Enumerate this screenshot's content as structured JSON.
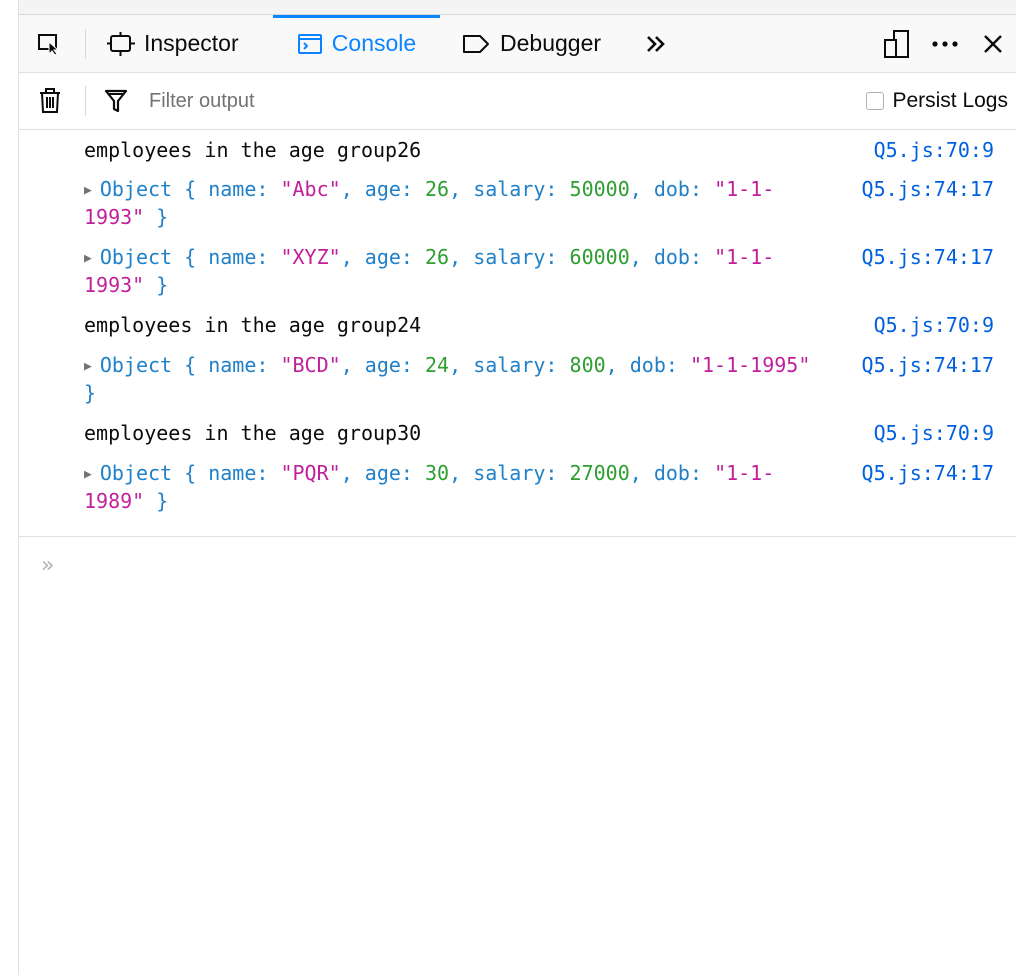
{
  "toolbar": {
    "pick_icon": "element-picker-icon",
    "tabs": [
      {
        "label": "Inspector",
        "icon": "inspector-icon",
        "selected": false
      },
      {
        "label": "Console",
        "icon": "console-icon",
        "selected": true
      },
      {
        "label": "Debugger",
        "icon": "debugger-icon",
        "selected": false
      }
    ],
    "overflow_icon": "chevrons-right-icon",
    "responsive_icon": "responsive-design-icon",
    "more_icon": "ellipsis-icon",
    "close_icon": "close-icon"
  },
  "filterbar": {
    "clear_icon": "trash-icon",
    "filter_icon": "funnel-icon",
    "filter_placeholder": "Filter output",
    "persist_label": "Persist Logs",
    "persist_checked": false
  },
  "messages": [
    {
      "type": "log",
      "text": "employees in the age group26",
      "location": "Q5.js:70:9"
    },
    {
      "type": "object",
      "label": "Object",
      "name": "\"Abc\"",
      "age": "26",
      "salary": "50000",
      "dob": "\"1-1-1993\"",
      "location": "Q5.js:74:17"
    },
    {
      "type": "object",
      "label": "Object",
      "name": "\"XYZ\"",
      "age": "26",
      "salary": "60000",
      "dob": "\"1-1-1993\"",
      "location": "Q5.js:74:17"
    },
    {
      "type": "log",
      "text": "employees in the age group24",
      "location": "Q5.js:70:9"
    },
    {
      "type": "object",
      "label": "Object",
      "name": "\"BCD\"",
      "age": "24",
      "salary": "800",
      "dob": "\"1-1-1995\"",
      "location": "Q5.js:74:17"
    },
    {
      "type": "log",
      "text": "employees in the age group30",
      "location": "Q5.js:70:9"
    },
    {
      "type": "object",
      "label": "Object",
      "name": "\"PQR\"",
      "age": "30",
      "salary": "27000",
      "dob": "\"1-1-1989\"",
      "location": "Q5.js:74:17"
    }
  ],
  "keys": {
    "name": "name:",
    "age": "age:",
    "salary": "salary:",
    "dob": "dob:"
  },
  "jsterm": {
    "prompt_icon": "prompt-chevron-icon",
    "prompt": "»"
  },
  "colors": {
    "accent": "#0a84ff",
    "link": "#0060df",
    "string": "#c21f9a",
    "number": "#2e9e30",
    "object": "#2080c8"
  }
}
